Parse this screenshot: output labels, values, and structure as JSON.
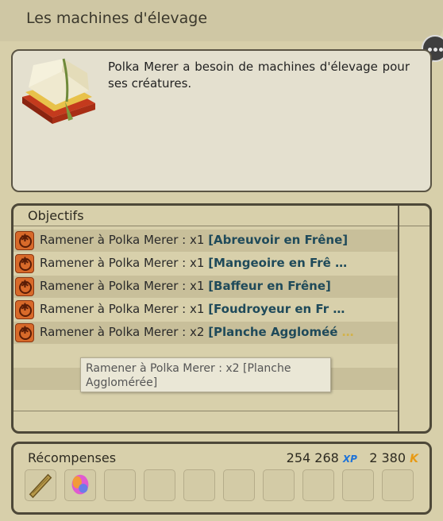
{
  "window": {
    "title": "Les machines d'élevage"
  },
  "quest": {
    "description": "Polka Merer a besoin de machines d'élevage pour ses créatures.",
    "icon": "book-icon"
  },
  "objectives": {
    "title": "Objectifs",
    "items": [
      {
        "prefix": "Ramener à Polka Merer : x1 ",
        "item": "[Abreuvoir en Frêne]",
        "ellipsis": ""
      },
      {
        "prefix": "Ramener à Polka Merer : x1 ",
        "item": "[Mangeoire en Frê",
        "ellipsis": " …"
      },
      {
        "prefix": "Ramener à Polka Merer : x1 ",
        "item": "[Baffeur en Frêne]",
        "ellipsis": ""
      },
      {
        "prefix": "Ramener à Polka Merer : x1 ",
        "item": "[Foudroyeur en Fr",
        "ellipsis": " …"
      },
      {
        "prefix": "Ramener à Polka Merer : x2 ",
        "item": "[Planche Aggloméé",
        "ellipsis": " …"
      }
    ],
    "tooltip": "Ramener à Polka Merer : x2 [Planche Agglomérée]"
  },
  "rewards": {
    "title": "Récompenses",
    "xp_value": "254 268",
    "xp_label": "XP",
    "kamas_value": "2 380",
    "kamas_label": "K",
    "slots": [
      "wooden-plank-icon",
      "feather-icon",
      "",
      "",
      "",
      "",
      "",
      "",
      "",
      ""
    ]
  },
  "colors": {
    "accent_item": "#1f4a5a",
    "xp": "#1e73d8",
    "kamas": "#e89a14",
    "objective_icon": "#d86a2a"
  }
}
